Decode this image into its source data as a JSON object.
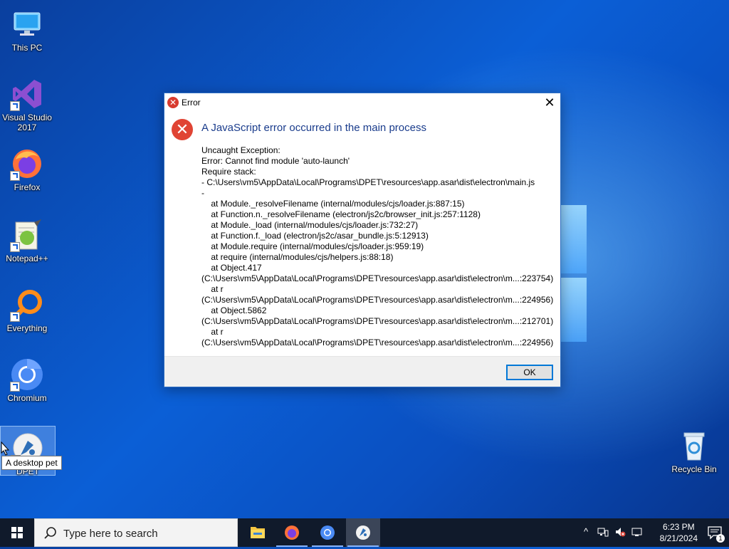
{
  "desktop": {
    "icons": [
      {
        "label": "This PC"
      },
      {
        "label": "Visual Studio 2017"
      },
      {
        "label": "Firefox"
      },
      {
        "label": "Notepad++"
      },
      {
        "label": "Everything"
      },
      {
        "label": "Chromium"
      },
      {
        "label": "DPET"
      },
      {
        "label": "Recycle Bin"
      }
    ],
    "tooltip": "A desktop pet"
  },
  "dialog": {
    "title": "Error",
    "heading": "A JavaScript error occurred in the main process",
    "message": "Uncaught Exception:\nError: Cannot find module 'auto-launch'\nRequire stack:\n- C:\\Users\\vm5\\AppData\\Local\\Programs\\DPET\\resources\\app.asar\\dist\\electron\\main.js\n-\n    at Module._resolveFilename (internal/modules/cjs/loader.js:887:15)\n    at Function.n._resolveFilename (electron/js2c/browser_init.js:257:1128)\n    at Module._load (internal/modules/cjs/loader.js:732:27)\n    at Function.f._load (electron/js2c/asar_bundle.js:5:12913)\n    at Module.require (internal/modules/cjs/loader.js:959:19)\n    at require (internal/modules/cjs/helpers.js:88:18)\n    at Object.417\n(C:\\Users\\vm5\\AppData\\Local\\Programs\\DPET\\resources\\app.asar\\dist\\electron\\m...:223754)\n    at r\n(C:\\Users\\vm5\\AppData\\Local\\Programs\\DPET\\resources\\app.asar\\dist\\electron\\m...:224956)\n    at Object.5862\n(C:\\Users\\vm5\\AppData\\Local\\Programs\\DPET\\resources\\app.asar\\dist\\electron\\m...:212701)\n    at r\n(C:\\Users\\vm5\\AppData\\Local\\Programs\\DPET\\resources\\app.asar\\dist\\electron\\m...:224956)",
    "ok_label": "OK",
    "close_glyph": "✕"
  },
  "taskbar": {
    "search_placeholder": "Type here to search",
    "apps": [
      "File Explorer",
      "Firefox",
      "Chromium",
      "DPET"
    ],
    "time": "6:23 PM",
    "date": "8/21/2024",
    "notification_count": "1"
  },
  "colors": {
    "accent": "#0078d7",
    "error_red": "#e04434",
    "heading_blue": "#1a3c8c",
    "taskbar_bg": "#101a2b"
  }
}
